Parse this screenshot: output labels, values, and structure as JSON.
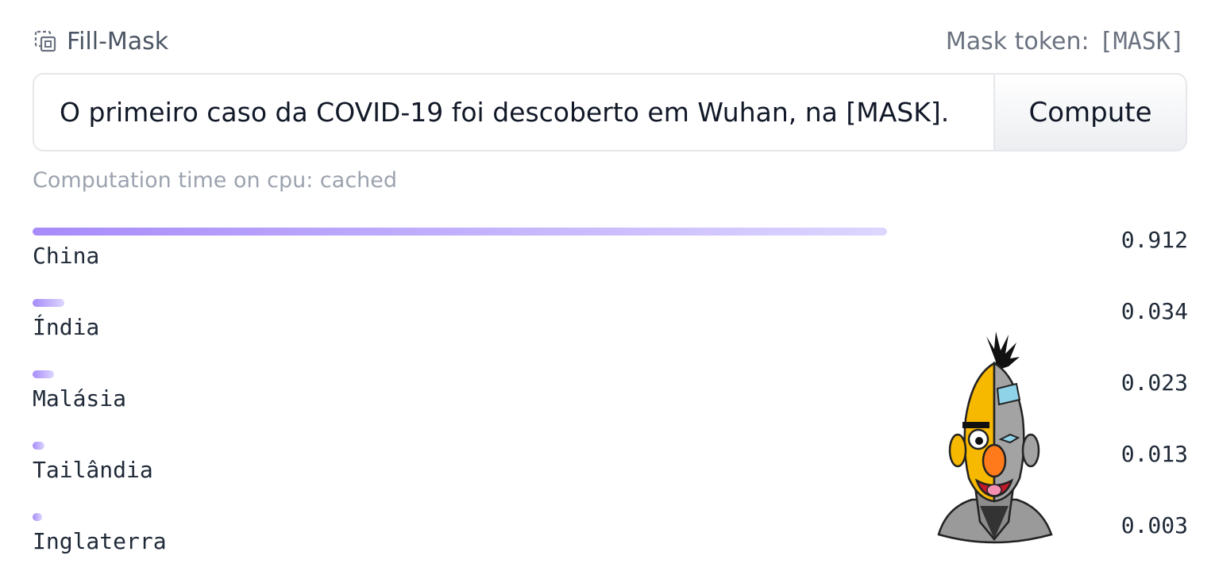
{
  "header": {
    "task_icon": "fill-mask-icon",
    "task_label": "Fill-Mask",
    "mask_label": "Mask token:",
    "mask_value": "[MASK]"
  },
  "input": {
    "value": "O primeiro caso da COVID-19 foi descoberto em Wuhan, na [MASK].",
    "button_label": "Compute"
  },
  "status": {
    "computation_time": "Computation time on cpu: cached"
  },
  "results": [
    {
      "label": "China",
      "score": "0.912",
      "fraction": 0.912
    },
    {
      "label": "Índia",
      "score": "0.034",
      "fraction": 0.034
    },
    {
      "label": "Malásia",
      "score": "0.023",
      "fraction": 0.023
    },
    {
      "label": "Tailândia",
      "score": "0.013",
      "fraction": 0.013
    },
    {
      "label": "Inglaterra",
      "score": "0.003",
      "fraction": 0.003
    }
  ],
  "colors": {
    "bar_start": "#a78bfa",
    "bar_end": "#ddd6fe"
  },
  "mascot": {
    "icon": "bert-robot-mascot"
  }
}
